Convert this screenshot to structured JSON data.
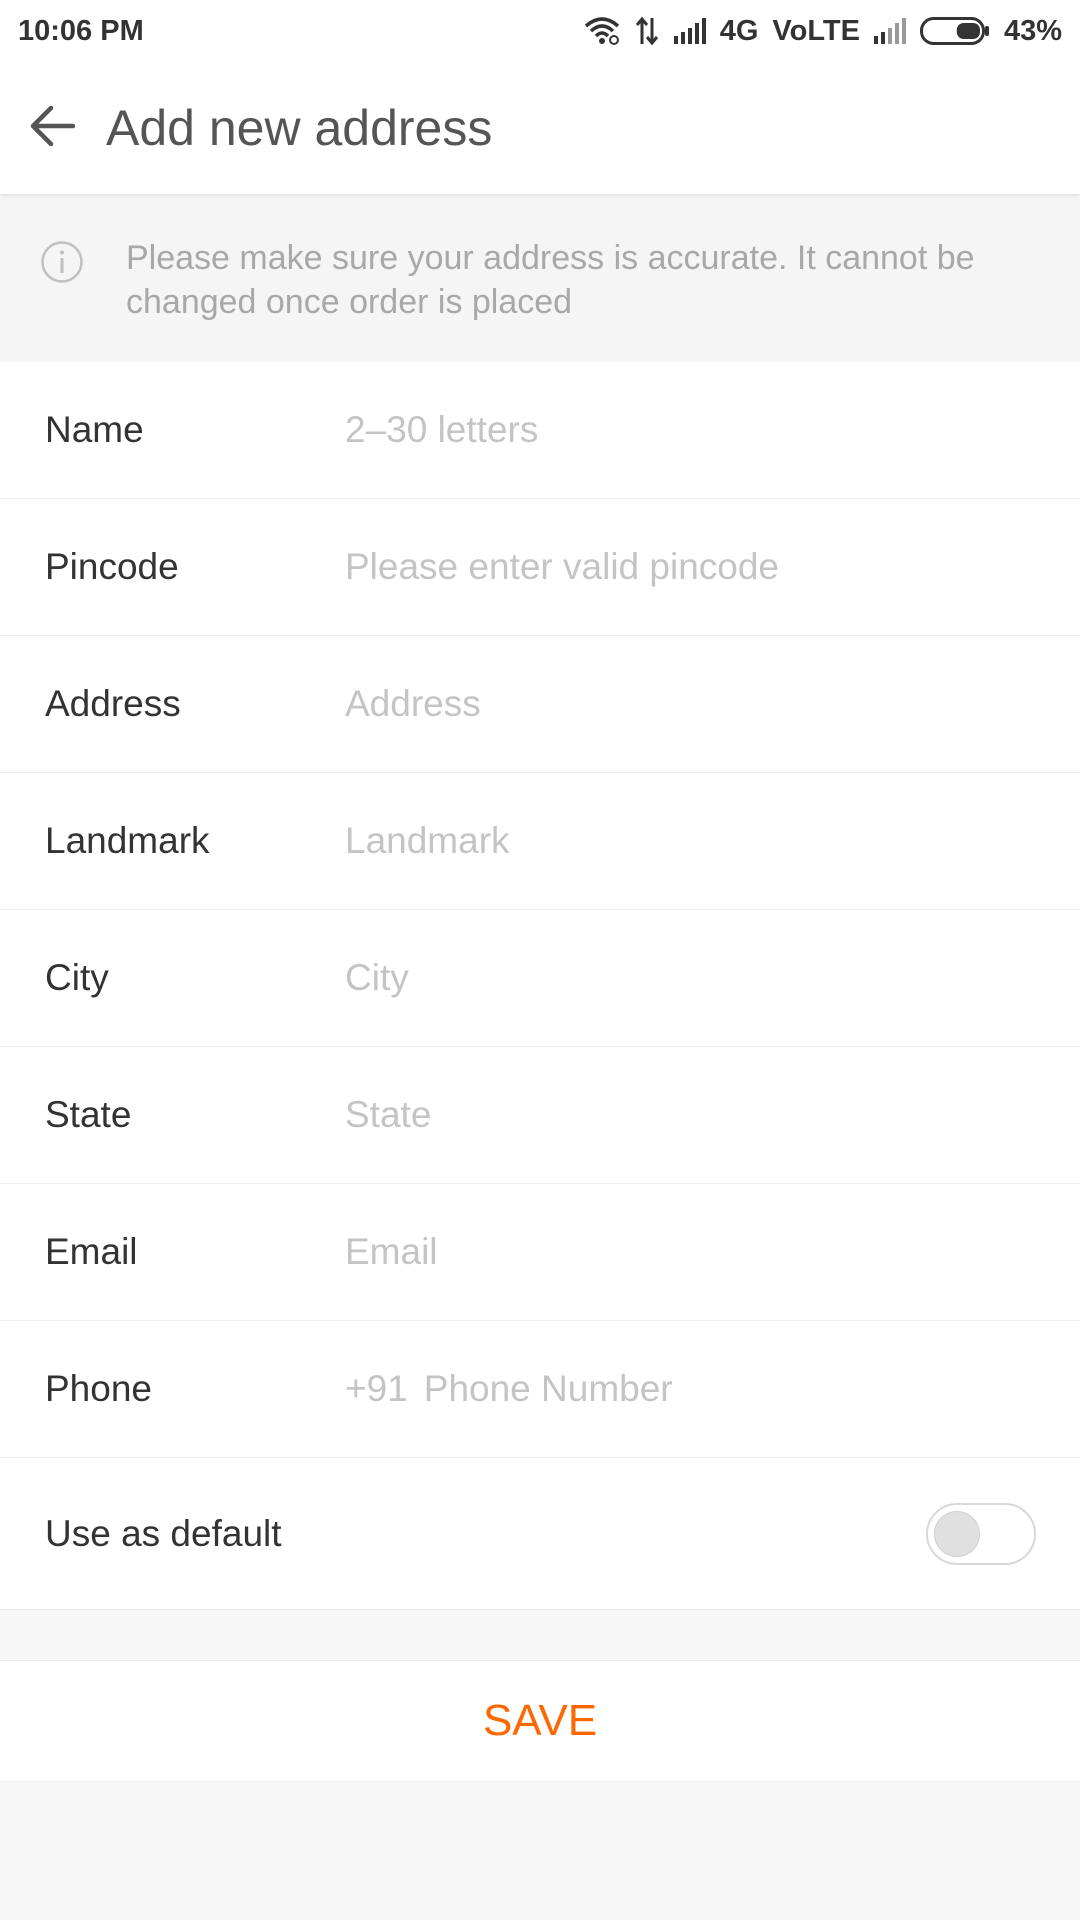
{
  "status_bar": {
    "time": "10:06 PM",
    "network": "4G",
    "volte": "VoLTE",
    "battery_percent": "43%",
    "battery_level": 0.43
  },
  "header": {
    "title": "Add new address",
    "back_icon": "arrow-left-icon"
  },
  "notice": {
    "icon": "info-icon",
    "text": "Please make sure your address is accurate. It cannot be changed once order is placed"
  },
  "form": {
    "fields": [
      {
        "label": "Name",
        "placeholder": "2–30 letters",
        "value": ""
      },
      {
        "label": "Pincode",
        "placeholder": "Please enter valid pincode",
        "value": ""
      },
      {
        "label": "Address",
        "placeholder": "Address",
        "value": ""
      },
      {
        "label": "Landmark",
        "placeholder": "Landmark",
        "value": ""
      },
      {
        "label": "City",
        "placeholder": "City",
        "value": ""
      },
      {
        "label": "State",
        "placeholder": "State",
        "value": ""
      },
      {
        "label": "Email",
        "placeholder": "Email",
        "value": ""
      },
      {
        "label": "Phone",
        "prefix": "+91",
        "placeholder": "Phone Number",
        "value": ""
      }
    ],
    "default_toggle": {
      "label": "Use as default",
      "checked": false
    }
  },
  "actions": {
    "save_label": "SAVE"
  },
  "colors": {
    "accent": "#ff6700",
    "label_text": "#333333",
    "placeholder_text": "#c4c4c4",
    "page_bg": "#f7f7f7"
  }
}
